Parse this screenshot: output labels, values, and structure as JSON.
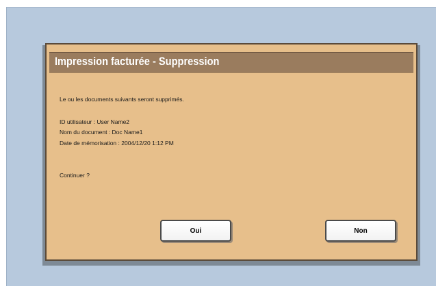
{
  "dialog": {
    "title": "Impression facturée - Suppression",
    "message": "Le ou les documents suivants seront supprimés.",
    "user_id_line": "ID utilisateur : User Name2",
    "document_name_line": "Nom du document : Doc Name1",
    "storage_date_line": "Date de mémorisation : 2004/12/20 1:12 PM",
    "confirm_prompt": "Continuer ?",
    "buttons": {
      "yes_label": "Oui",
      "no_label": "Non"
    }
  },
  "colors": {
    "screen_background": "#b7c9dd",
    "dialog_background": "#e7bf8b",
    "title_bar": "#9a7c5e",
    "title_text": "#ffffff"
  }
}
